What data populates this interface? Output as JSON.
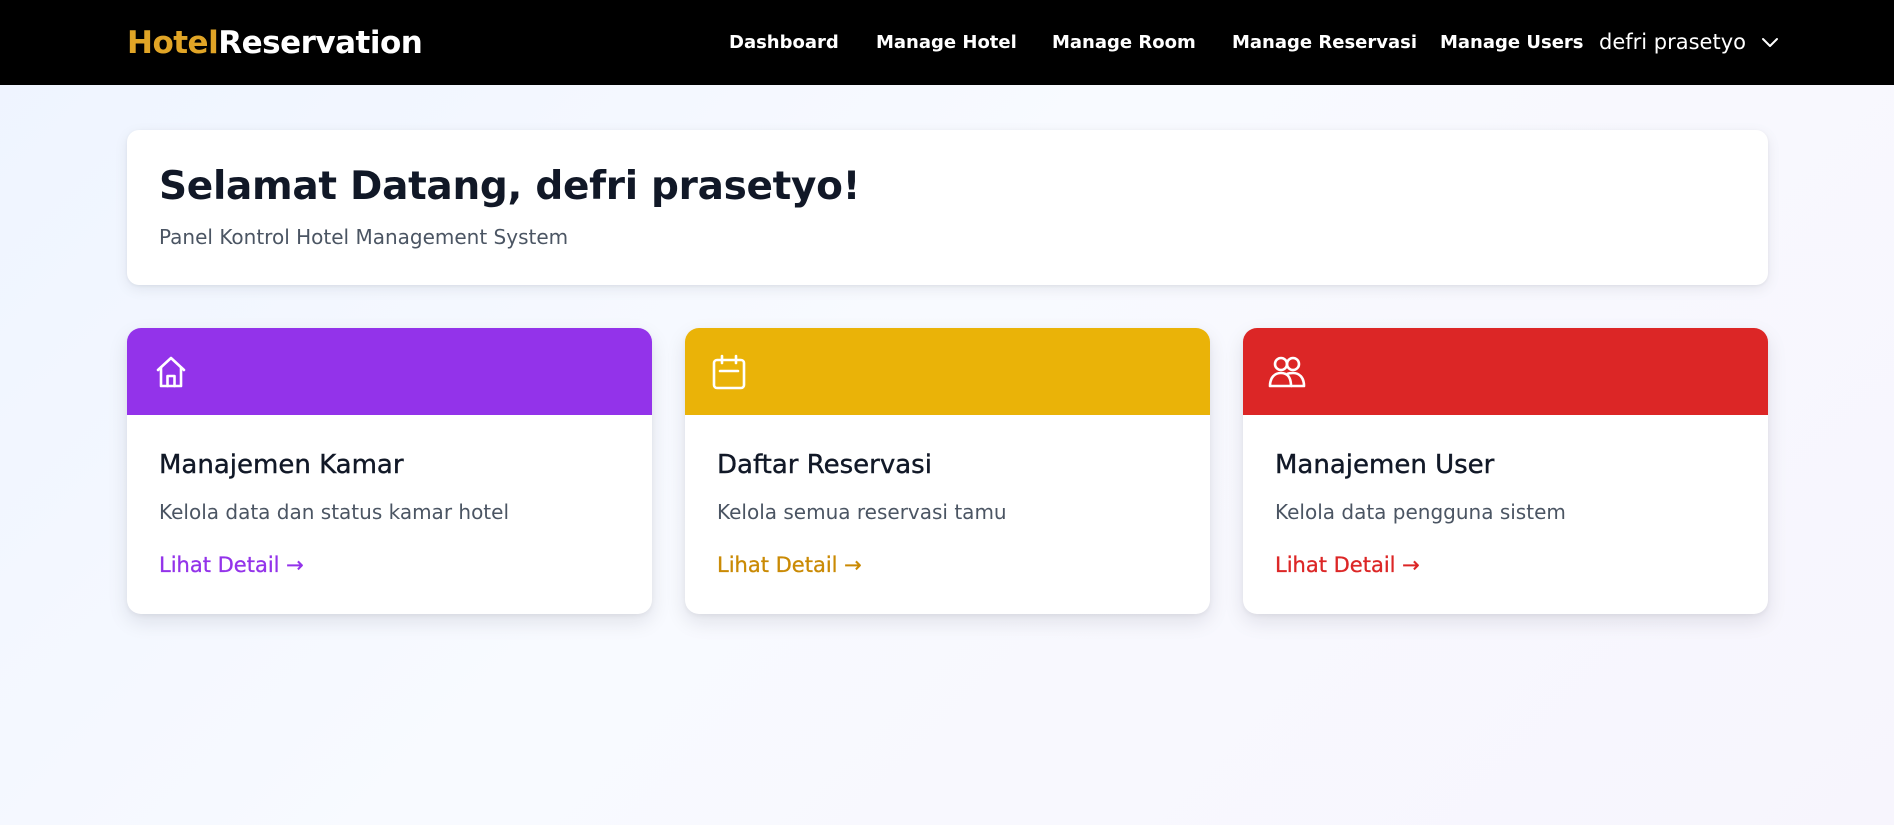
{
  "brand": {
    "part1": "Hotel",
    "part2": "Reservation",
    "accent_color": "#e1a526"
  },
  "nav": {
    "items": [
      {
        "label": "Dashboard"
      },
      {
        "label": "Manage Hotel"
      },
      {
        "label": "Manage Room"
      },
      {
        "label": "Manage Reservasi"
      },
      {
        "label": "Manage Users"
      }
    ],
    "user_name": "defri prasetyo",
    "user_menu_icon": "chevron-down-icon"
  },
  "welcome": {
    "title": "Selamat Datang, defri prasetyo!",
    "subtitle": "Panel Kontrol Hotel Management System"
  },
  "cards": [
    {
      "icon": "home-icon",
      "color": "#9333ea",
      "title": "Manajemen Kamar",
      "description": "Kelola data dan status kamar hotel",
      "link": "Lihat Detail →"
    },
    {
      "icon": "calendar-icon",
      "color": "#eab308",
      "link_color": "#ca8a04",
      "title": "Daftar Reservasi",
      "description": "Kelola semua reservasi tamu",
      "link": "Lihat Detail →"
    },
    {
      "icon": "users-icon",
      "color": "#dc2626",
      "title": "Manajemen User",
      "description": "Kelola data pengguna sistem",
      "link": "Lihat Detail →"
    }
  ]
}
